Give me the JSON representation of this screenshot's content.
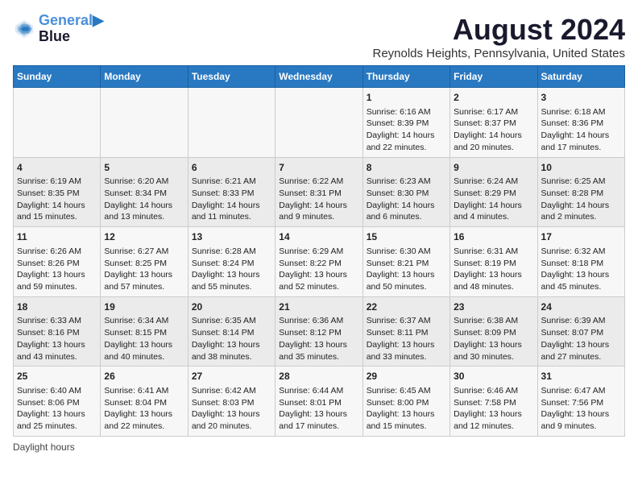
{
  "header": {
    "logo_line1": "General",
    "logo_line2": "Blue",
    "title": "August 2024",
    "subtitle": "Reynolds Heights, Pennsylvania, United States"
  },
  "days_of_week": [
    "Sunday",
    "Monday",
    "Tuesday",
    "Wednesday",
    "Thursday",
    "Friday",
    "Saturday"
  ],
  "weeks": [
    [
      {
        "day": "",
        "info": ""
      },
      {
        "day": "",
        "info": ""
      },
      {
        "day": "",
        "info": ""
      },
      {
        "day": "",
        "info": ""
      },
      {
        "day": "1",
        "info": "Sunrise: 6:16 AM\nSunset: 8:39 PM\nDaylight: 14 hours and 22 minutes."
      },
      {
        "day": "2",
        "info": "Sunrise: 6:17 AM\nSunset: 8:37 PM\nDaylight: 14 hours and 20 minutes."
      },
      {
        "day": "3",
        "info": "Sunrise: 6:18 AM\nSunset: 8:36 PM\nDaylight: 14 hours and 17 minutes."
      }
    ],
    [
      {
        "day": "4",
        "info": "Sunrise: 6:19 AM\nSunset: 8:35 PM\nDaylight: 14 hours and 15 minutes."
      },
      {
        "day": "5",
        "info": "Sunrise: 6:20 AM\nSunset: 8:34 PM\nDaylight: 14 hours and 13 minutes."
      },
      {
        "day": "6",
        "info": "Sunrise: 6:21 AM\nSunset: 8:33 PM\nDaylight: 14 hours and 11 minutes."
      },
      {
        "day": "7",
        "info": "Sunrise: 6:22 AM\nSunset: 8:31 PM\nDaylight: 14 hours and 9 minutes."
      },
      {
        "day": "8",
        "info": "Sunrise: 6:23 AM\nSunset: 8:30 PM\nDaylight: 14 hours and 6 minutes."
      },
      {
        "day": "9",
        "info": "Sunrise: 6:24 AM\nSunset: 8:29 PM\nDaylight: 14 hours and 4 minutes."
      },
      {
        "day": "10",
        "info": "Sunrise: 6:25 AM\nSunset: 8:28 PM\nDaylight: 14 hours and 2 minutes."
      }
    ],
    [
      {
        "day": "11",
        "info": "Sunrise: 6:26 AM\nSunset: 8:26 PM\nDaylight: 13 hours and 59 minutes."
      },
      {
        "day": "12",
        "info": "Sunrise: 6:27 AM\nSunset: 8:25 PM\nDaylight: 13 hours and 57 minutes."
      },
      {
        "day": "13",
        "info": "Sunrise: 6:28 AM\nSunset: 8:24 PM\nDaylight: 13 hours and 55 minutes."
      },
      {
        "day": "14",
        "info": "Sunrise: 6:29 AM\nSunset: 8:22 PM\nDaylight: 13 hours and 52 minutes."
      },
      {
        "day": "15",
        "info": "Sunrise: 6:30 AM\nSunset: 8:21 PM\nDaylight: 13 hours and 50 minutes."
      },
      {
        "day": "16",
        "info": "Sunrise: 6:31 AM\nSunset: 8:19 PM\nDaylight: 13 hours and 48 minutes."
      },
      {
        "day": "17",
        "info": "Sunrise: 6:32 AM\nSunset: 8:18 PM\nDaylight: 13 hours and 45 minutes."
      }
    ],
    [
      {
        "day": "18",
        "info": "Sunrise: 6:33 AM\nSunset: 8:16 PM\nDaylight: 13 hours and 43 minutes."
      },
      {
        "day": "19",
        "info": "Sunrise: 6:34 AM\nSunset: 8:15 PM\nDaylight: 13 hours and 40 minutes."
      },
      {
        "day": "20",
        "info": "Sunrise: 6:35 AM\nSunset: 8:14 PM\nDaylight: 13 hours and 38 minutes."
      },
      {
        "day": "21",
        "info": "Sunrise: 6:36 AM\nSunset: 8:12 PM\nDaylight: 13 hours and 35 minutes."
      },
      {
        "day": "22",
        "info": "Sunrise: 6:37 AM\nSunset: 8:11 PM\nDaylight: 13 hours and 33 minutes."
      },
      {
        "day": "23",
        "info": "Sunrise: 6:38 AM\nSunset: 8:09 PM\nDaylight: 13 hours and 30 minutes."
      },
      {
        "day": "24",
        "info": "Sunrise: 6:39 AM\nSunset: 8:07 PM\nDaylight: 13 hours and 27 minutes."
      }
    ],
    [
      {
        "day": "25",
        "info": "Sunrise: 6:40 AM\nSunset: 8:06 PM\nDaylight: 13 hours and 25 minutes."
      },
      {
        "day": "26",
        "info": "Sunrise: 6:41 AM\nSunset: 8:04 PM\nDaylight: 13 hours and 22 minutes."
      },
      {
        "day": "27",
        "info": "Sunrise: 6:42 AM\nSunset: 8:03 PM\nDaylight: 13 hours and 20 minutes."
      },
      {
        "day": "28",
        "info": "Sunrise: 6:44 AM\nSunset: 8:01 PM\nDaylight: 13 hours and 17 minutes."
      },
      {
        "day": "29",
        "info": "Sunrise: 6:45 AM\nSunset: 8:00 PM\nDaylight: 13 hours and 15 minutes."
      },
      {
        "day": "30",
        "info": "Sunrise: 6:46 AM\nSunset: 7:58 PM\nDaylight: 13 hours and 12 minutes."
      },
      {
        "day": "31",
        "info": "Sunrise: 6:47 AM\nSunset: 7:56 PM\nDaylight: 13 hours and 9 minutes."
      }
    ]
  ],
  "footer": {
    "note": "Daylight hours"
  }
}
